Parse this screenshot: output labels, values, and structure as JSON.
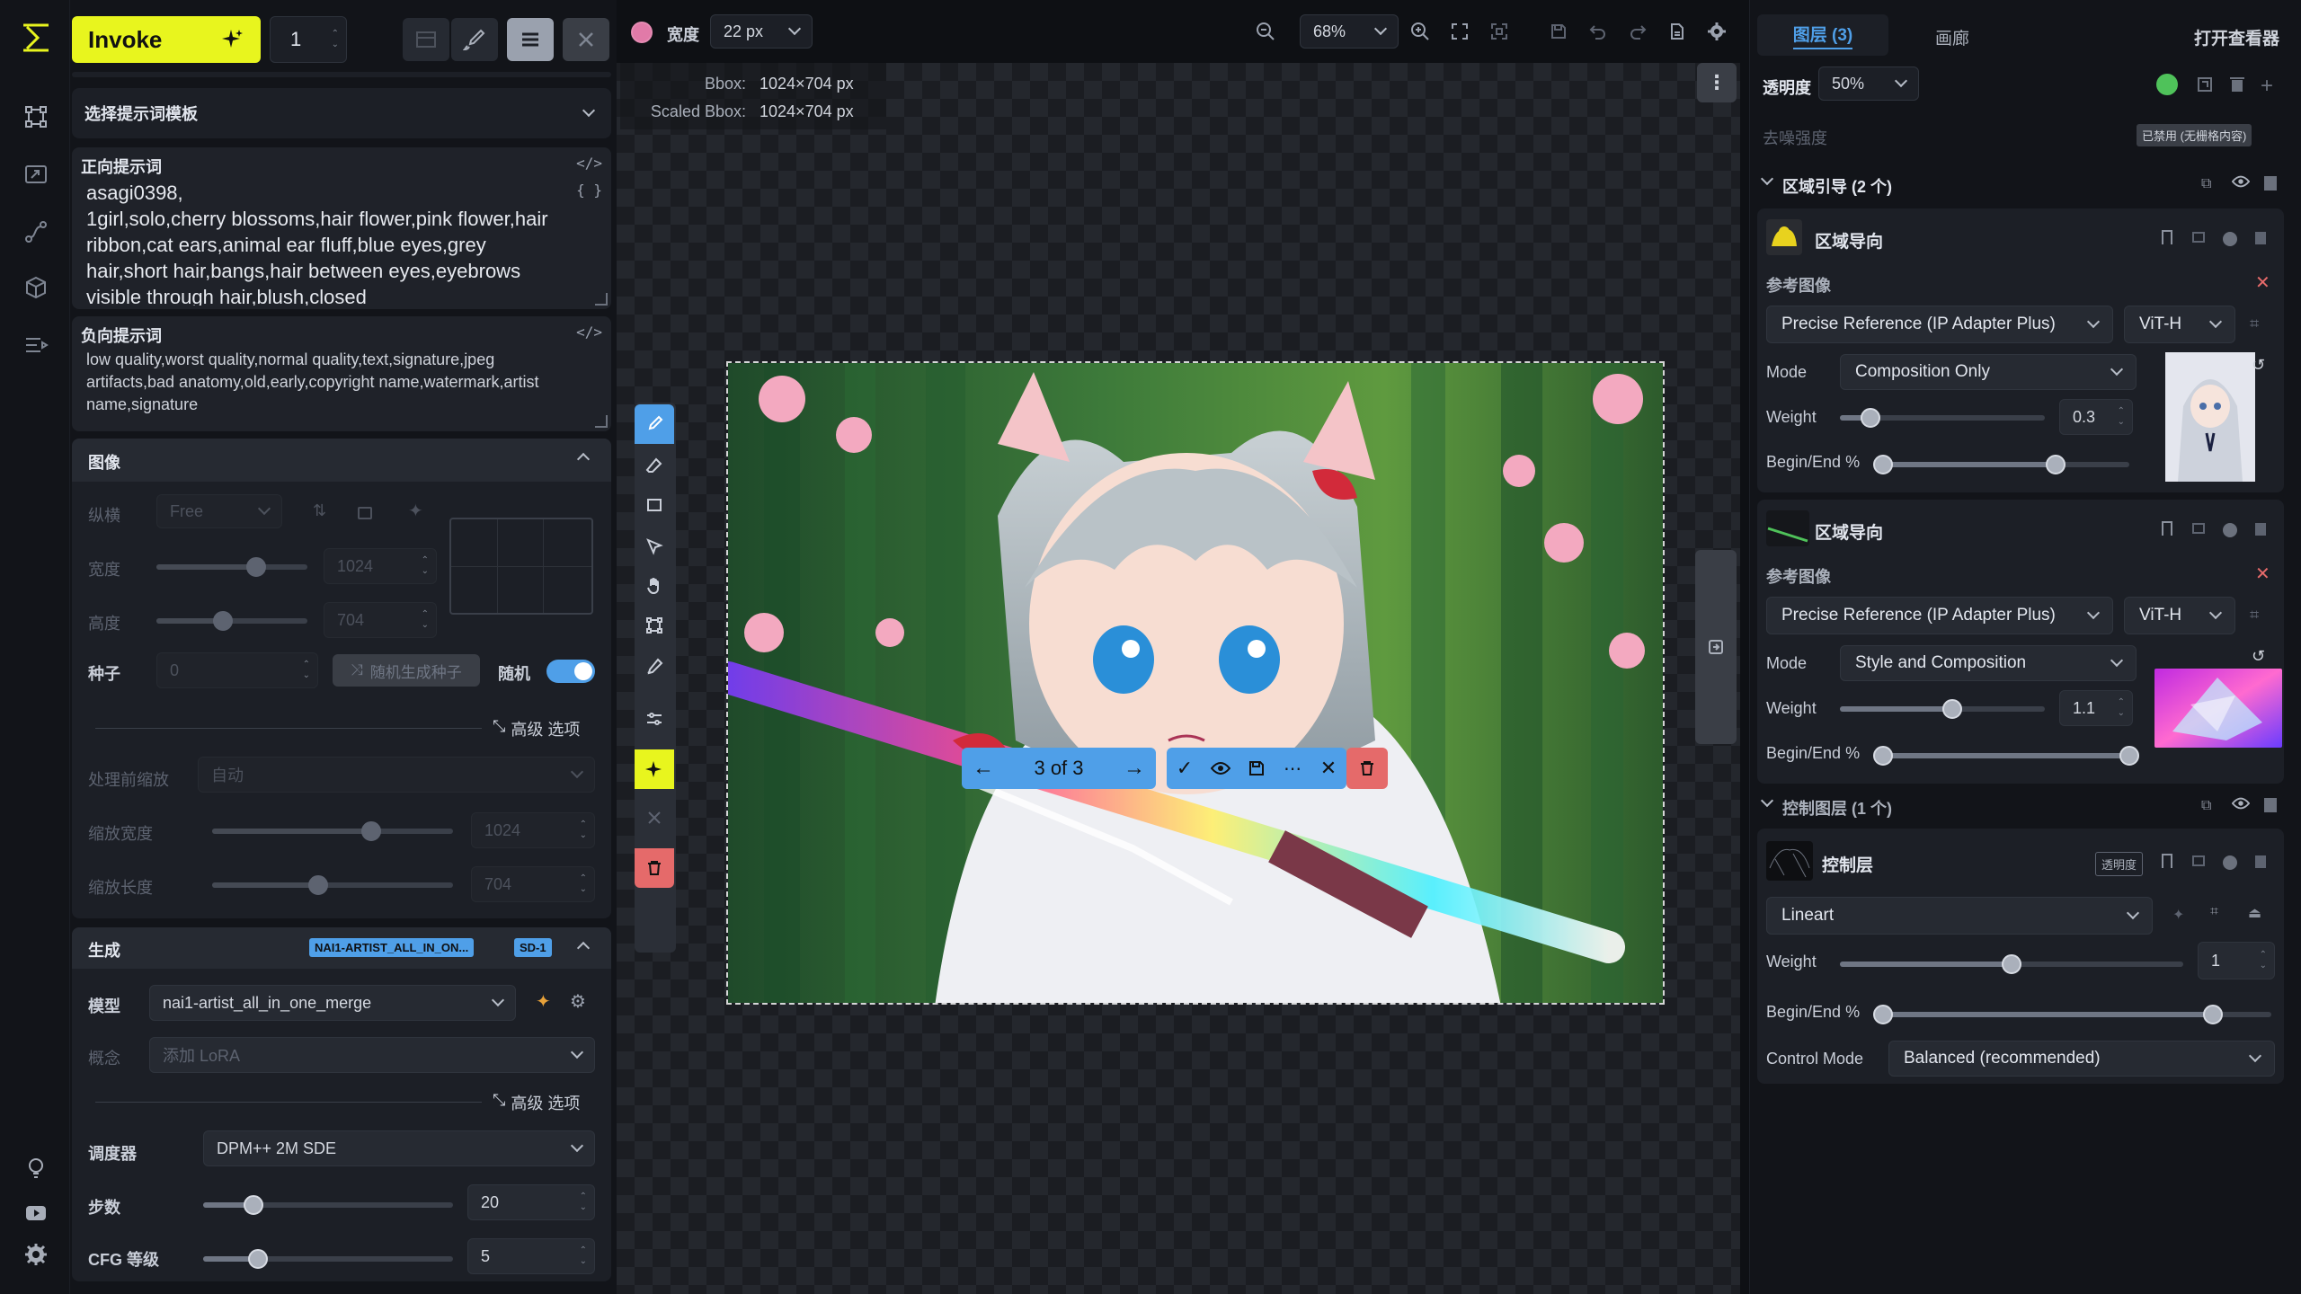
{
  "app": {
    "invoke_label": "Invoke",
    "iterations": "1"
  },
  "prompt_template": {
    "title": "选择提示词模板"
  },
  "positive_prompt": {
    "title": "正向提示词",
    "text": "asagi0398,\n1girl,solo,cherry blossoms,hair flower,pink flower,hair ribbon,cat ears,animal ear fluff,blue eyes,grey hair,short hair,bangs,hair between eyes,eyebrows visible through hair,blush,closed"
  },
  "negative_prompt": {
    "title": "负向提示词",
    "text": "low quality,worst quality,normal quality,text,signature,jpeg artifacts,bad anatomy,old,early,copyright name,watermark,artist name,signature"
  },
  "image_section": {
    "title": "图像",
    "aspect_label": "纵横",
    "aspect_value": "Free",
    "width_label": "宽度",
    "width_value": "1024",
    "width_fraction": 0.66,
    "height_label": "高度",
    "height_value": "704",
    "height_fraction": 0.44,
    "seed_label": "种子",
    "seed_value": "0",
    "random_seed_btn": "随机生成种子",
    "random_label": "随机",
    "random_on": true,
    "advanced_label": "高级 选项",
    "prescale_label": "处理前缩放",
    "prescale_value": "自动",
    "scaled_w_label": "缩放宽度",
    "scaled_w_value": "1024",
    "scaled_w_fraction": 0.66,
    "scaled_h_label": "缩放长度",
    "scaled_h_value": "704",
    "scaled_h_fraction": 0.44
  },
  "generation": {
    "title": "生成",
    "model_badge": "NAI1-ARTIST_ALL_IN_ON...",
    "base_badge": "SD-1",
    "model_label": "模型",
    "model_value": "nai1-artist_all_in_one_merge",
    "concept_label": "概念",
    "concept_placeholder": "添加 LoRA",
    "advanced_label": "高级 选项",
    "scheduler_label": "调度器",
    "scheduler_value": "DPM++ 2M SDE",
    "steps_label": "步数",
    "steps_value": "20",
    "steps_fraction": 0.2,
    "cfg_label": "CFG 等级",
    "cfg_value": "5",
    "cfg_fraction": 0.22
  },
  "canvas_toolbar": {
    "brush_width_label": "宽度",
    "brush_width_value": "22 px",
    "zoom_value": "68%"
  },
  "bbox": {
    "bbox_label": "Bbox:",
    "bbox_value": "1024×704 px",
    "scaled_label": "Scaled Bbox:",
    "scaled_value": "1024×704 px"
  },
  "staging": {
    "counter": "3 of 3"
  },
  "right_panel": {
    "tabs": [
      "图层 (3)",
      "画廊",
      "打开查看器"
    ],
    "opacity_label": "透明度",
    "opacity_value": "50%",
    "denoise_label": "去噪强度",
    "denoise_badge": "已禁用 (无栅格内容)",
    "regional_group": "区域引导 (2 个)",
    "regional": [
      {
        "title": "区域导向",
        "ref_label": "参考图像",
        "adapter": "Precise Reference (IP Adapter Plus)",
        "clip": "ViT-H",
        "mode_label": "Mode",
        "mode": "Composition Only",
        "weight_label": "Weight",
        "weight": "0.3",
        "weight_fraction": 0.15,
        "begin_end_label": "Begin/End %",
        "begin_fraction": 0.0,
        "end_fraction": 0.7
      },
      {
        "title": "区域导向",
        "ref_label": "参考图像",
        "adapter": "Precise Reference (IP Adapter Plus)",
        "clip": "ViT-H",
        "mode_label": "Mode",
        "mode": "Style and Composition",
        "weight_label": "Weight",
        "weight": "1.1",
        "weight_fraction": 0.55,
        "begin_end_label": "Begin/End %",
        "begin_fraction": 0.0,
        "end_fraction": 1.0
      }
    ],
    "control_group": "控制图层 (1 个)",
    "control": {
      "title": "控制层",
      "badge": "透明度",
      "model": "Lineart",
      "weight_label": "Weight",
      "weight": "1",
      "weight_fraction": 0.5,
      "begin_end_label": "Begin/End %",
      "begin_fraction": 0.0,
      "end_fraction": 0.85,
      "control_mode_label": "Control Mode",
      "control_mode": "Balanced (recommended)"
    }
  },
  "colors": {
    "accent": "#e8f51e",
    "blue": "#4f9fe8",
    "danger": "#e56a6a",
    "brush": "#e17aa8"
  }
}
